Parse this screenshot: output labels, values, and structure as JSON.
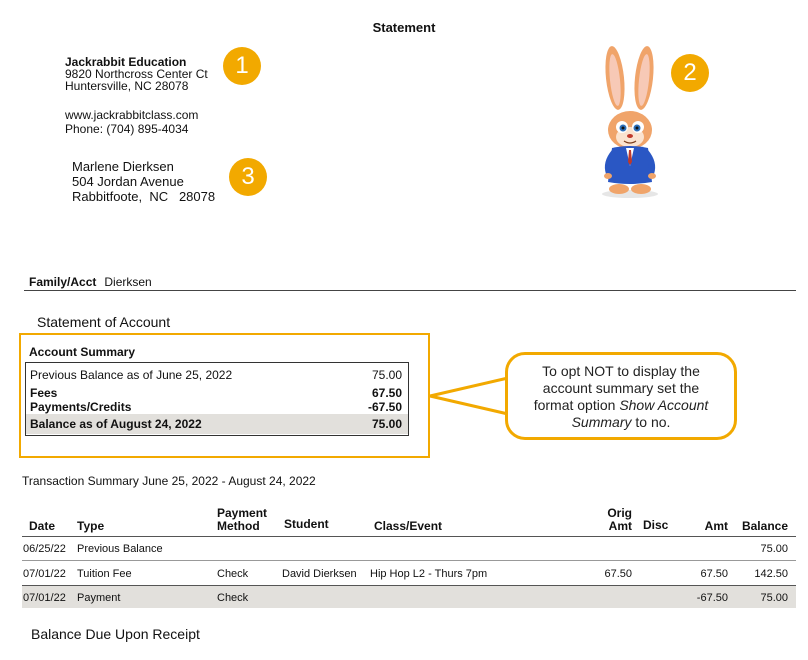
{
  "statement_title": "Statement",
  "company": {
    "name": "Jackrabbit Education",
    "address_line1": "9820 Northcross Center Ct",
    "address_line2": "Huntersville, NC 28078",
    "website": "www.jackrabbitclass.com",
    "phone": "Phone: (704) 895-4034"
  },
  "recipient": {
    "name": "Marlene Dierksen",
    "street": "504 Jordan Avenue",
    "city_state_zip": "Rabbitfoote,  NC   28078"
  },
  "badges": {
    "one": "1",
    "two": "2",
    "three": "3"
  },
  "family": {
    "label": "Family/Acct",
    "value": "Dierksen"
  },
  "statement_of_account": "Statement of Account",
  "account_summary": {
    "heading": "Account Summary",
    "rows": [
      {
        "label": "Previous Balance as of June 25, 2022",
        "value": "75.00"
      },
      {
        "label": "Fees",
        "value": "67.50"
      },
      {
        "label": "Payments/Credits",
        "value": "-67.50"
      },
      {
        "label": "Balance as of August 24, 2022",
        "value": "75.00"
      }
    ]
  },
  "callout": {
    "line1": "To opt NOT to display the",
    "line2": "account summary set the",
    "line3_prefix": "format option ",
    "line3_italic": "Show Account",
    "line4_italic": "Summary",
    "line4_suffix": " to no."
  },
  "transaction_summary_title": "Transaction Summary June 25, 2022 - August 24, 2022",
  "table": {
    "headers": {
      "date": "Date",
      "type": "Type",
      "payment_method_1": "Payment",
      "payment_method_2": "Method",
      "student": "Student",
      "class_event": "Class/Event",
      "orig_amt_1": "Orig",
      "orig_amt_2": "Amt",
      "disc": "Disc",
      "amt": "Amt",
      "balance": "Balance"
    },
    "rows": [
      {
        "date": "06/25/22",
        "type": "Previous Balance",
        "method": "",
        "student": "",
        "class": "",
        "orig": "",
        "disc": "",
        "amt": "",
        "balance": "75.00"
      },
      {
        "date": "07/01/22",
        "type": "Tuition Fee",
        "method": "Check",
        "student": "David Dierksen",
        "class": "Hip Hop L2 - Thurs 7pm",
        "orig": "67.50",
        "disc": "",
        "amt": "67.50",
        "balance": "142.50"
      },
      {
        "date": "07/01/22",
        "type": "Payment",
        "method": "Check",
        "student": "",
        "class": "",
        "orig": "",
        "disc": "",
        "amt": "-67.50",
        "balance": "75.00"
      }
    ]
  },
  "footer": "Balance Due Upon Receipt",
  "colors": {
    "accent": "#F2A900",
    "shade": "#e2e0dc"
  },
  "icons": {
    "mascot": "rabbit-mascot-icon"
  }
}
